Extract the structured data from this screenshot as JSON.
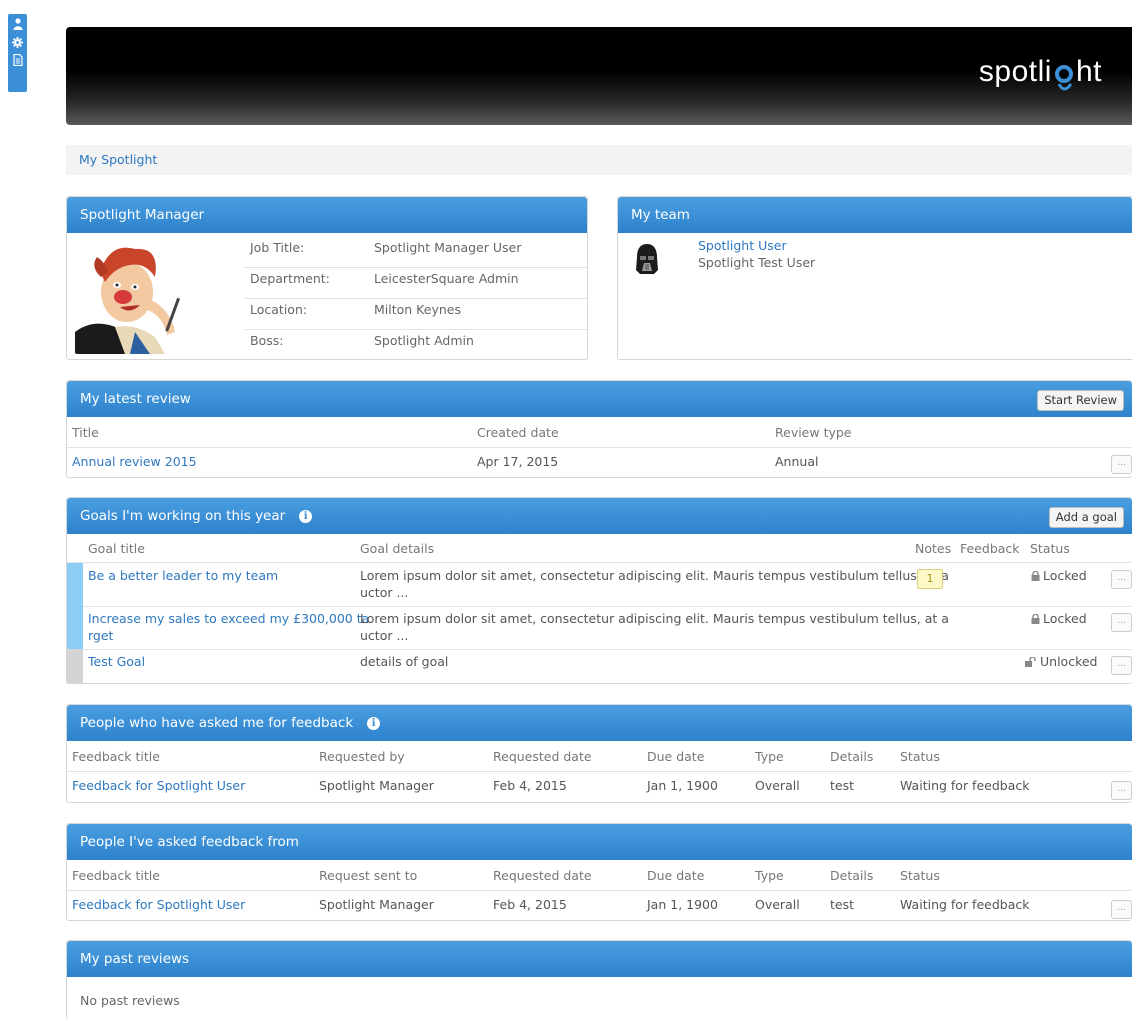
{
  "sidebar_tools": [
    {
      "icon": "user-icon"
    },
    {
      "icon": "gear-icon"
    },
    {
      "icon": "document-icon"
    }
  ],
  "brand": {
    "logo_part1": "spotli",
    "logo_part2": "ht"
  },
  "breadcrumb": "My Spotlight",
  "profile": {
    "title": "Spotlight Manager",
    "fields": [
      {
        "label": "Job Title:",
        "value": "Spotlight Manager User"
      },
      {
        "label": "Department:",
        "value": "LeicesterSquare Admin"
      },
      {
        "label": "Location:",
        "value": "Milton Keynes"
      },
      {
        "label": "Boss:",
        "value": "Spotlight Admin"
      }
    ]
  },
  "team": {
    "title": "My team",
    "member_name": "Spotlight User",
    "member_role": "Spotlight Test User"
  },
  "latest_review": {
    "title": "My latest review",
    "button": "Start Review",
    "headers": [
      "Title",
      "Created date",
      "Review type"
    ],
    "rows": [
      {
        "title": "Annual review 2015",
        "created": "Apr 17, 2015",
        "type": "Annual"
      }
    ]
  },
  "goals": {
    "title": "Goals I'm working on this year",
    "button": "Add a goal",
    "headers": [
      "Goal title",
      "Goal details",
      "Notes",
      "Feedback",
      "Status"
    ],
    "rows": [
      {
        "title_l1": "Be a better leader to my team",
        "title_l2": "",
        "details_l1": "Lorem ipsum dolor sit amet, consectetur adipiscing elit. Mauris tempus vestibulum tellus, at a",
        "details_l2": "uctor ...",
        "notes": "1",
        "status": "Locked",
        "color": "#8ecdf5"
      },
      {
        "title_l1": "Increase my sales to exceed my £300,000 ta",
        "title_l2": "rget",
        "details_l1": "Lorem ipsum dolor sit amet, consectetur adipiscing elit. Mauris tempus vestibulum tellus, at a",
        "details_l2": "uctor ...",
        "notes": "",
        "status": "Locked",
        "color": "#8ecdf5"
      },
      {
        "title_l1": "Test Goal",
        "title_l2": "",
        "details_l1": "details of goal",
        "details_l2": "",
        "notes": "",
        "status": "Unlocked",
        "color": "#d4d4d4"
      }
    ]
  },
  "asked_me": {
    "title": "People who have asked me for feedback",
    "headers": [
      "Feedback title",
      "Requested by",
      "Requested date",
      "Due date",
      "Type",
      "Details",
      "Status"
    ],
    "rows": [
      {
        "title": "Feedback for Spotlight User",
        "by": "Spotlight Manager",
        "date": "Feb 4, 2015",
        "due": "Jan 1, 1900",
        "type": "Overall",
        "details": "test",
        "status": "Waiting for feedback"
      }
    ]
  },
  "asked_from": {
    "title": "People I've asked feedback from",
    "headers": [
      "Feedback title",
      "Request sent to",
      "Requested date",
      "Due date",
      "Type",
      "Details",
      "Status"
    ],
    "rows": [
      {
        "title": "Feedback for Spotlight User",
        "by": "Spotlight Manager",
        "date": "Feb 4, 2015",
        "due": "Jan 1, 1900",
        "type": "Overall",
        "details": "test",
        "status": "Waiting for feedback"
      }
    ]
  },
  "past_reviews": {
    "title": "My past reviews",
    "empty": "No past reviews"
  },
  "more_label": "...",
  "colors": {
    "accent": "#3a8fd6",
    "link": "#2e78c0"
  }
}
